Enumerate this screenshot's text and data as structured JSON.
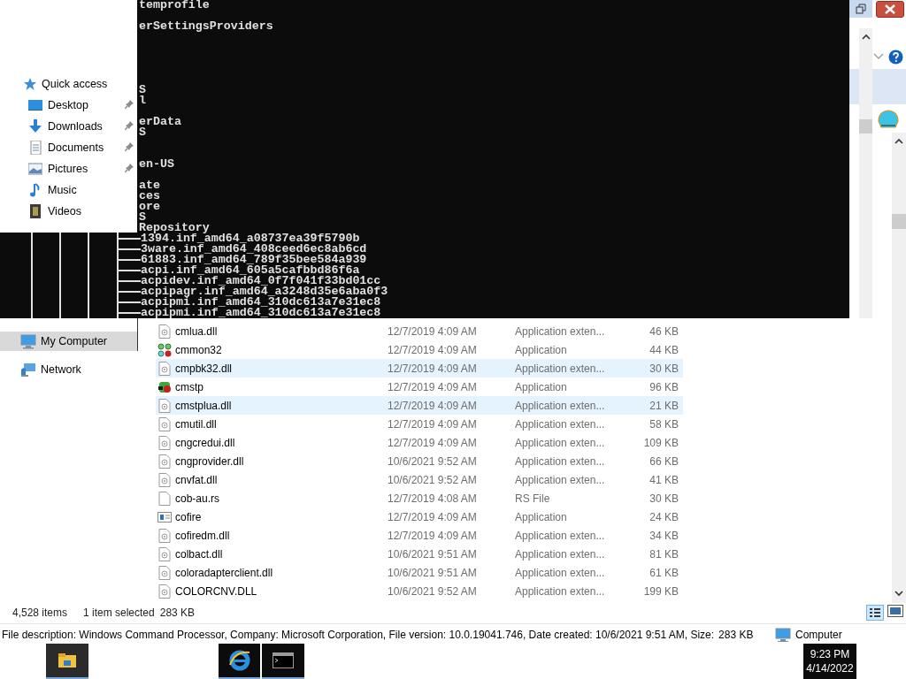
{
  "console": {
    "lines": [
      {
        "kind": "text",
        "text": "temprofile"
      },
      {
        "kind": "blank"
      },
      {
        "kind": "text",
        "text": "erSettingsProviders"
      },
      {
        "kind": "blank"
      },
      {
        "kind": "blank"
      },
      {
        "kind": "blank"
      },
      {
        "kind": "blank"
      },
      {
        "kind": "blank"
      },
      {
        "kind": "text",
        "text": "S"
      },
      {
        "kind": "text",
        "text": "l"
      },
      {
        "kind": "blank"
      },
      {
        "kind": "text",
        "text": "erData"
      },
      {
        "kind": "text",
        "text": "S"
      },
      {
        "kind": "blank"
      },
      {
        "kind": "blank"
      },
      {
        "kind": "text",
        "text": "en-US"
      },
      {
        "kind": "blank"
      },
      {
        "kind": "text",
        "text": "ate"
      },
      {
        "kind": "text",
        "text": "ces"
      },
      {
        "kind": "text",
        "text": "ore"
      },
      {
        "kind": "text",
        "text": "S"
      },
      {
        "kind": "text",
        "text": "Repository"
      },
      {
        "kind": "branch",
        "text": "1394.inf_amd64_a08737ea39f5790b"
      },
      {
        "kind": "branch",
        "text": "3ware.inf_amd64_408ceed6ec8ab6cd"
      },
      {
        "kind": "branch",
        "text": "61883.inf_amd64_789f35bee584a939"
      },
      {
        "kind": "branch",
        "text": "acpi.inf_amd64_605a5cafbbd86f6a"
      },
      {
        "kind": "branch",
        "text": "acpidev.inf_amd64_0f7f041f33bd01cc"
      },
      {
        "kind": "branch",
        "text": "acpipagr.inf_amd64_a3248d35e6aba0f3"
      },
      {
        "kind": "branch",
        "text": "acpipmi.inf_amd64_310dc613a7e31ec8"
      },
      {
        "kind": "branch",
        "text": "acpipmi.inf_amd64_310dc613a7e31ec8"
      }
    ]
  },
  "quick_access": {
    "title": "Quick access",
    "items": [
      {
        "label": "Desktop",
        "kind": "desktop",
        "pinned": true
      },
      {
        "label": "Downloads",
        "kind": "downloads",
        "pinned": true
      },
      {
        "label": "Documents",
        "kind": "documents",
        "pinned": true
      },
      {
        "label": "Pictures",
        "kind": "pictures",
        "pinned": true
      },
      {
        "label": "Music",
        "kind": "music",
        "pinned": false
      },
      {
        "label": "Videos",
        "kind": "videos",
        "pinned": false
      }
    ]
  },
  "nav_bottom": [
    {
      "label": "My Computer",
      "kind": "computer",
      "selected": true
    },
    {
      "label": "Network",
      "kind": "network",
      "selected": false
    }
  ],
  "files": [
    {
      "name": "cmlua.dll",
      "date": "12/7/2019 4:09 AM",
      "type": "Application exten...",
      "size": "46 KB",
      "kind": "dll",
      "selected": false
    },
    {
      "name": "cmmon32",
      "date": "12/7/2019 4:09 AM",
      "type": "Application",
      "size": "44 KB",
      "kind": "phonebook",
      "selected": false
    },
    {
      "name": "cmpbk32.dll",
      "date": "12/7/2019 4:09 AM",
      "type": "Application exten...",
      "size": "30 KB",
      "kind": "dll",
      "selected": true
    },
    {
      "name": "cmstp",
      "date": "12/7/2019 4:09 AM",
      "type": "Application",
      "size": "96 KB",
      "kind": "setup",
      "selected": false
    },
    {
      "name": "cmstplua.dll",
      "date": "12/7/2019 4:09 AM",
      "type": "Application exten...",
      "size": "21 KB",
      "kind": "dll",
      "selected": true
    },
    {
      "name": "cmutil.dll",
      "date": "12/7/2019 4:09 AM",
      "type": "Application exten...",
      "size": "58 KB",
      "kind": "dll",
      "selected": false
    },
    {
      "name": "cngcredui.dll",
      "date": "12/7/2019 4:09 AM",
      "type": "Application exten...",
      "size": "109 KB",
      "kind": "dll",
      "selected": false
    },
    {
      "name": "cngprovider.dll",
      "date": "10/6/2021 9:52 AM",
      "type": "Application exten...",
      "size": "66 KB",
      "kind": "dll",
      "selected": false
    },
    {
      "name": "cnvfat.dll",
      "date": "10/6/2021 9:52 AM",
      "type": "Application exten...",
      "size": "41 KB",
      "kind": "dll",
      "selected": false
    },
    {
      "name": "cob-au.rs",
      "date": "12/7/2019 4:08 AM",
      "type": "RS File",
      "size": "30 KB",
      "kind": "file",
      "selected": false
    },
    {
      "name": "cofire",
      "date": "12/7/2019 4:09 AM",
      "type": "Application",
      "size": "24 KB",
      "kind": "window",
      "selected": false
    },
    {
      "name": "cofiredm.dll",
      "date": "12/7/2019 4:09 AM",
      "type": "Application exten...",
      "size": "34 KB",
      "kind": "dll",
      "selected": false
    },
    {
      "name": "colbact.dll",
      "date": "10/6/2021 9:51 AM",
      "type": "Application exten...",
      "size": "81 KB",
      "kind": "dll",
      "selected": false
    },
    {
      "name": "coloradapterclient.dll",
      "date": "10/6/2021 9:51 AM",
      "type": "Application exten...",
      "size": "61 KB",
      "kind": "dll",
      "selected": false
    },
    {
      "name": "COLORCNV.DLL",
      "date": "10/6/2021 9:52 AM",
      "type": "Application exten...",
      "size": "199 KB",
      "kind": "dll",
      "selected": false
    }
  ],
  "status_bar": {
    "item_count": "4,528 items",
    "selection": "1 item selected",
    "selection_size": "283 KB"
  },
  "details_bar": {
    "description": "File description: Windows Command Processor, Company: Microsoft Corporation, File version: 10.0.19041.746, Date created: 10/6/2021 9:51 AM, Size:",
    "size": "283 KB",
    "location": "Computer"
  },
  "taskbar": {
    "apps": [
      {
        "kind": "explorer"
      },
      {
        "kind": "browser"
      },
      {
        "kind": "console"
      }
    ],
    "time": "9:23 PM",
    "date": "4/14/2022"
  }
}
